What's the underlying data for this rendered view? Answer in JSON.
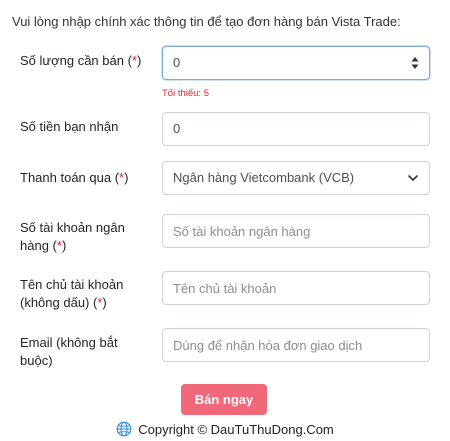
{
  "intro": "Vui lòng nhập chính xác thông tin để tạo đơn hàng bán Vista Trade:",
  "required_mark": "*",
  "fields": {
    "quantity": {
      "label": "Số lượng cần bán (",
      "label_end": ")",
      "value": "0",
      "hint": "Tối thiểu: 5"
    },
    "amount": {
      "label": "Số tiền bạn nhận",
      "value": "0"
    },
    "payment": {
      "label": "Thanh toán qua (",
      "label_end": ")",
      "selected": "Ngân hàng Vietcombank (VCB)"
    },
    "account_number": {
      "label_line1": "Số tài khoản ngân",
      "label_line2": "hàng (",
      "label_end": ")",
      "placeholder": "Số tài khoản ngân hàng"
    },
    "account_name": {
      "label_line1": "Tên chủ tài khoản",
      "label_line2": "(không dấu) (",
      "label_end": ")",
      "placeholder": "Tên chủ tài khoản"
    },
    "email": {
      "label_line1": "Email (không bắt",
      "label_line2": "buộc)",
      "placeholder": "Dùng để nhận hóa đơn giao dịch"
    }
  },
  "submit_label": "Bán ngay",
  "footer": {
    "text": "Copyright © DauTuThuDong.Com",
    "icon": "globe-icon"
  },
  "colors": {
    "accent_button": "#f0687a",
    "required": "#e02424"
  }
}
